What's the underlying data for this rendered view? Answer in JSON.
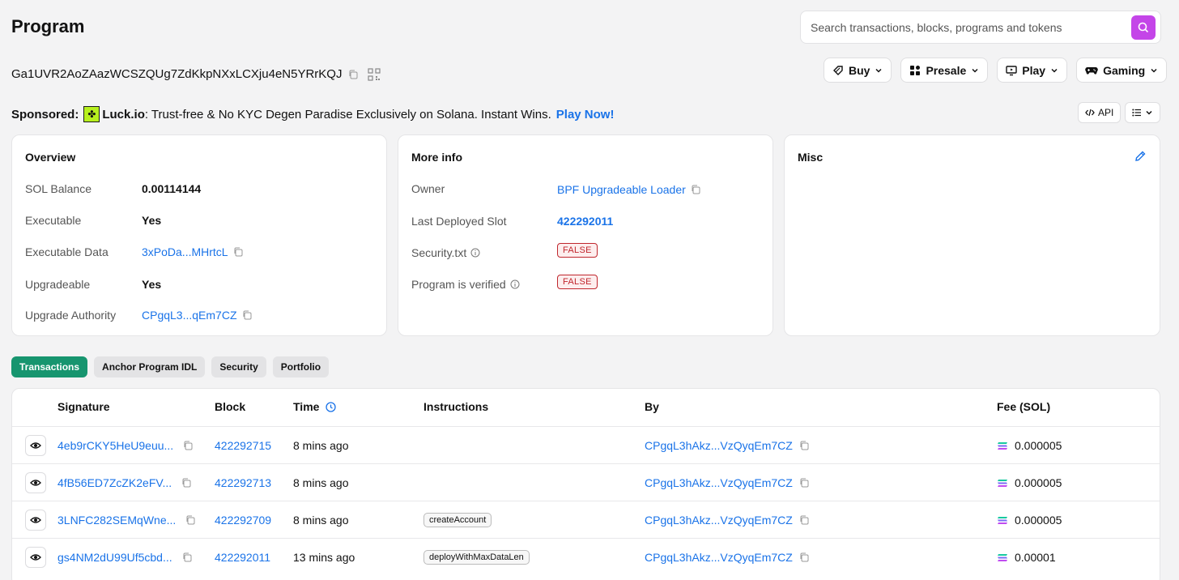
{
  "page": {
    "title": "Program"
  },
  "search": {
    "placeholder": "Search transactions, blocks, programs and tokens"
  },
  "address": "Ga1UVR2AoZAazWCSZQUg7ZdKkpNXxLCXju4eN5YRrKQJ",
  "pills": [
    {
      "label": "Buy",
      "icon": "tag-icon"
    },
    {
      "label": "Presale",
      "icon": "grid-icon"
    },
    {
      "label": "Play",
      "icon": "monitor-icon"
    },
    {
      "label": "Gaming",
      "icon": "gamepad-icon"
    }
  ],
  "sponsored": {
    "prefix": "Sponsored:",
    "brand": "Luck.io",
    "text": ": Trust-free & No KYC Degen Paradise Exclusively on Solana. Instant Wins.",
    "cta": "Play Now!"
  },
  "api_label": "API",
  "overview": {
    "title": "Overview",
    "rows": [
      {
        "label": "SOL Balance",
        "value": "0.00114144"
      },
      {
        "label": "Executable",
        "value": "Yes"
      },
      {
        "label": "Executable Data",
        "value": "3xPoDa...MHrtcL"
      },
      {
        "label": "Upgradeable",
        "value": "Yes"
      },
      {
        "label": "Upgrade Authority",
        "value": "CPgqL3...qEm7CZ"
      }
    ]
  },
  "more_info": {
    "title": "More info",
    "rows": [
      {
        "label": "Owner",
        "value": "BPF Upgradeable Loader"
      },
      {
        "label": "Last Deployed Slot",
        "value": "422292011"
      },
      {
        "label": "Security.txt",
        "value": "FALSE"
      },
      {
        "label": "Program is verified",
        "value": "FALSE"
      }
    ]
  },
  "misc": {
    "title": "Misc"
  },
  "tabs": [
    "Transactions",
    "Anchor Program IDL",
    "Security",
    "Portfolio"
  ],
  "table": {
    "headers": {
      "signature": "Signature",
      "block": "Block",
      "time": "Time",
      "instructions": "Instructions",
      "by": "By",
      "fee": "Fee (SOL)"
    },
    "rows": [
      {
        "signature": "4eb9rCKY5HeU9euu...",
        "block": "422292715",
        "time": "8 mins ago",
        "instruction": "",
        "by": "CPgqL3hAkz...VzQyqEm7CZ",
        "fee": "0.000005"
      },
      {
        "signature": "4fB56ED7ZcZK2eFV...",
        "block": "422292713",
        "time": "8 mins ago",
        "instruction": "",
        "by": "CPgqL3hAkz...VzQyqEm7CZ",
        "fee": "0.000005"
      },
      {
        "signature": "3LNFC282SEMqWne...",
        "block": "422292709",
        "time": "8 mins ago",
        "instruction": "createAccount",
        "by": "CPgqL3hAkz...VzQyqEm7CZ",
        "fee": "0.000005"
      },
      {
        "signature": "gs4NM2dU99Uf5cbd...",
        "block": "422292011",
        "time": "13 mins ago",
        "instruction": "deployWithMaxDataLen",
        "by": "CPgqL3hAkz...VzQyqEm7CZ",
        "fee": "0.00001"
      }
    ]
  },
  "colors": {
    "accent": "#c445e8",
    "link": "#1a73e8",
    "tab_active": "#17956f",
    "false_badge": "#c0262d"
  }
}
